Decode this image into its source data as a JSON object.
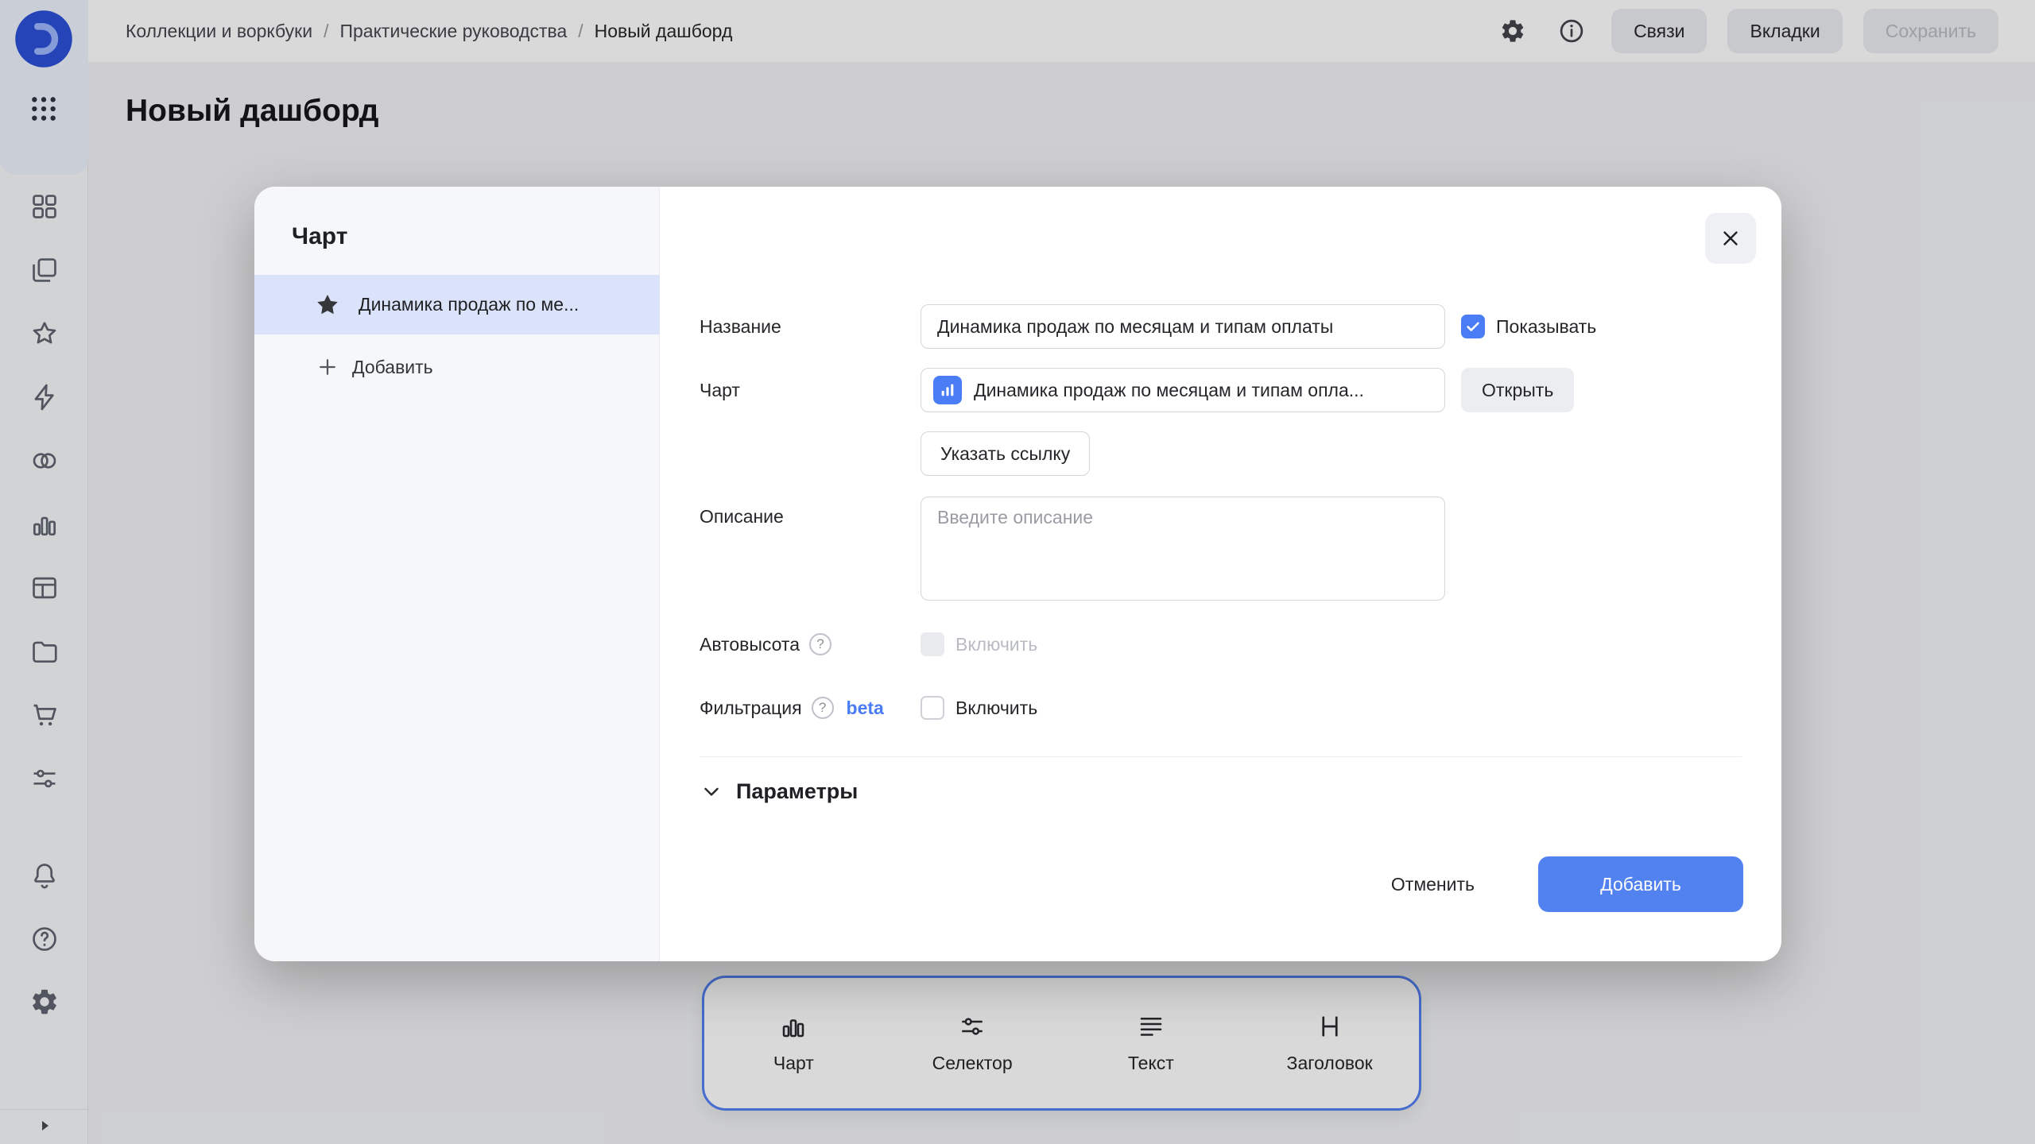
{
  "colors": {
    "accent": "#4a7cf5",
    "primary_button": "#5282f0",
    "toolbar_border": "#527ff2",
    "selected_item_bg": "#dbe3fa"
  },
  "sidebar": {
    "icons": [
      "logo",
      "apps-grid",
      "widgets",
      "collections",
      "star",
      "bolt",
      "circles",
      "bar-chart",
      "table",
      "folder",
      "cart",
      "sliders",
      "bell",
      "help",
      "gear",
      "expand"
    ]
  },
  "header": {
    "breadcrumbs": [
      "Коллекции и воркбуки",
      "Практические руководства",
      "Новый дашборд"
    ],
    "separator": "/",
    "links_button": "Связи",
    "tabs_button": "Вкладки",
    "save_button": "Сохранить"
  },
  "page": {
    "title": "Новый дашборд"
  },
  "modal": {
    "panel": {
      "title": "Чарт",
      "selected_item": "Динамика продаж по ме...",
      "add_button": "Добавить"
    },
    "form": {
      "name_label": "Название",
      "name_value": "Динамика продаж по месяцам и типам оплаты",
      "show_checkbox_label": "Показывать",
      "show_checkbox_checked": true,
      "chart_label": "Чарт",
      "chart_value": "Динамика продаж по месяцам и типам опла...",
      "open_button": "Открыть",
      "link_button": "Указать ссылку",
      "description_label": "Описание",
      "description_placeholder": "Введите описание",
      "autoheight_label": "Автовысота",
      "autoheight_checkbox_label": "Включить",
      "autoheight_checked": false,
      "autoheight_disabled": true,
      "filtering_label": "Фильтрация",
      "filtering_beta": "beta",
      "filtering_checkbox_label": "Включить",
      "filtering_checked": false,
      "params_section": "Параметры",
      "help_glyph": "?"
    },
    "footer": {
      "cancel_button": "Отменить",
      "submit_button": "Добавить"
    }
  },
  "toolbar": {
    "items": [
      {
        "label": "Чарт"
      },
      {
        "label": "Селектор"
      },
      {
        "label": "Текст"
      },
      {
        "label": "Заголовок"
      }
    ]
  }
}
